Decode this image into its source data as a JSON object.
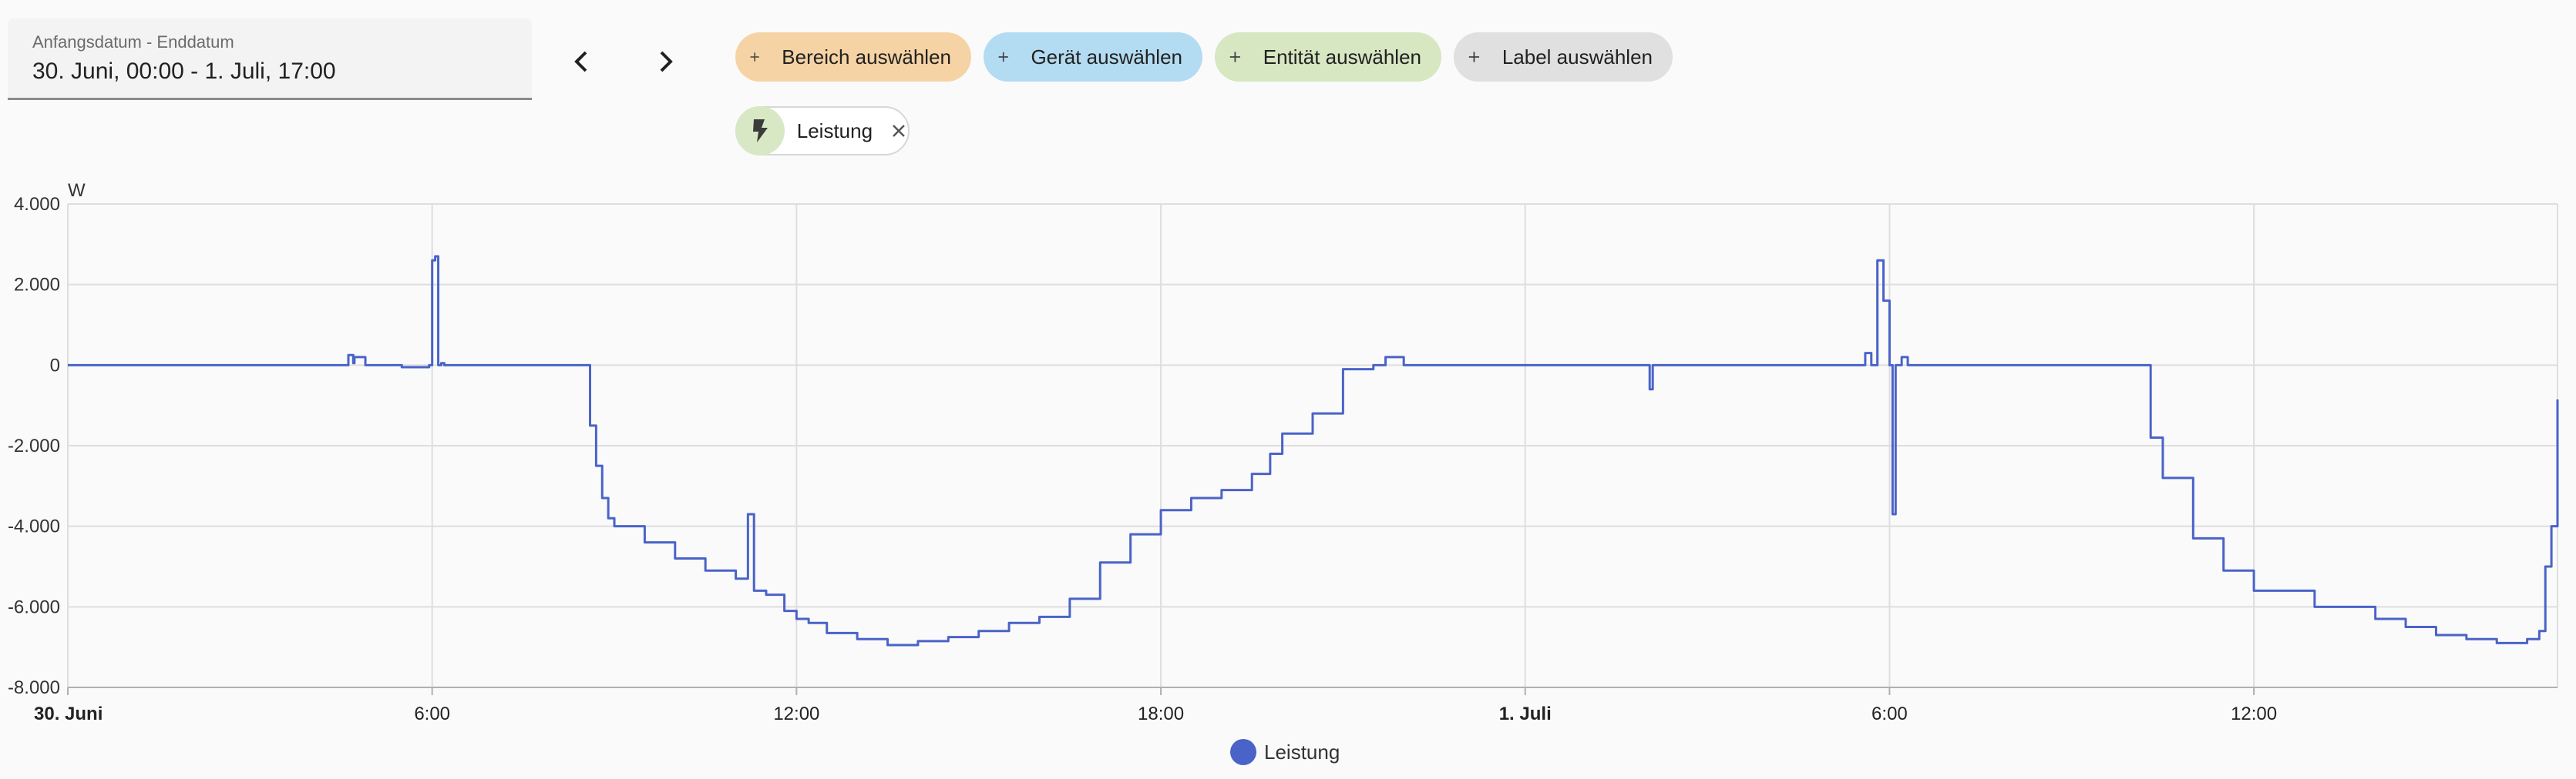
{
  "date_picker": {
    "label": "Anfangsdatum - Enddatum",
    "value": "30. Juni, 00:00 - 1. Juli, 17:00"
  },
  "nav": {
    "prev_icon": "chevron-left-icon",
    "next_icon": "chevron-right-icon"
  },
  "target_chips": [
    {
      "label": "Bereich auswählen",
      "color": "#f6d3a4",
      "icon": "plus-icon"
    },
    {
      "label": "Gerät auswählen",
      "color": "#b3dcf2",
      "icon": "plus-icon"
    },
    {
      "label": "Entität auswählen",
      "color": "#d6e7c2",
      "icon": "plus-icon"
    },
    {
      "label": "Label auswählen",
      "color": "#e0e0e0",
      "icon": "plus-icon"
    }
  ],
  "selected_filter": {
    "label": "Leistung",
    "icon": "flash-icon",
    "remove_icon": "close-icon"
  },
  "chart_data": {
    "type": "line",
    "unit_label": "W",
    "ylim": [
      -8000,
      4000
    ],
    "yticks": [
      {
        "v": 4000,
        "label": "4.000"
      },
      {
        "v": 2000,
        "label": "2.000"
      },
      {
        "v": 0,
        "label": "0"
      },
      {
        "v": -2000,
        "label": "-2.000"
      },
      {
        "v": -4000,
        "label": "-4.000"
      },
      {
        "v": -6000,
        "label": "-6.000"
      },
      {
        "v": -8000,
        "label": "-8.000"
      }
    ],
    "xlim": [
      0,
      41
    ],
    "xticks": [
      {
        "h": 0,
        "label": "30. Juni",
        "bold": true
      },
      {
        "h": 6,
        "label": "6:00",
        "bold": false
      },
      {
        "h": 12,
        "label": "12:00",
        "bold": false
      },
      {
        "h": 18,
        "label": "18:00",
        "bold": false
      },
      {
        "h": 24,
        "label": "1. Juli",
        "bold": true
      },
      {
        "h": 30,
        "label": "6:00",
        "bold": false
      },
      {
        "h": 36,
        "label": "12:00",
        "bold": false
      }
    ],
    "grid": true,
    "legend_position": "bottom-center",
    "series": [
      {
        "name": "Leistung",
        "color": "#4a63c8",
        "x": [
          0,
          4.6,
          4.62,
          4.7,
          4.72,
          4.9,
          5.5,
          5.95,
          6.0,
          6.05,
          6.1,
          6.15,
          6.2,
          7.5,
          8.5,
          8.6,
          8.7,
          8.8,
          8.9,
          9.0,
          9.5,
          10.0,
          10.5,
          11.0,
          11.2,
          11.3,
          11.5,
          11.8,
          12.0,
          12.2,
          12.5,
          13.0,
          13.5,
          14.0,
          14.5,
          15.0,
          15.5,
          16.0,
          16.5,
          17.0,
          17.5,
          18.0,
          18.5,
          19.0,
          19.5,
          19.8,
          20.0,
          20.5,
          21.0,
          21.5,
          21.7,
          22.0,
          23.0,
          24.0,
          25.0,
          26.0,
          26.05,
          26.1,
          27.0,
          28.0,
          29.0,
          29.5,
          29.6,
          29.7,
          29.8,
          29.9,
          30.0,
          30.05,
          30.1,
          30.2,
          30.3,
          30.5,
          31.0,
          32.0,
          33.0,
          33.5,
          34.0,
          34.3,
          34.5,
          35.0,
          35.5,
          36.0,
          37.0,
          38.0,
          38.5,
          39.0,
          39.5,
          40.0,
          40.5,
          40.7,
          40.8,
          40.9,
          41.0
        ],
        "y": [
          0,
          0,
          250,
          50,
          200,
          0,
          -50,
          0,
          2600,
          2700,
          0,
          50,
          0,
          0,
          0,
          -1500,
          -2500,
          -3300,
          -3800,
          -4000,
          -4400,
          -4800,
          -5100,
          -5300,
          -3700,
          -5600,
          -5700,
          -6100,
          -6300,
          -6400,
          -6650,
          -6800,
          -6950,
          -6850,
          -6750,
          -6600,
          -6400,
          -6250,
          -5800,
          -4900,
          -4200,
          -3600,
          -3300,
          -3100,
          -2700,
          -2200,
          -1700,
          -1200,
          -100,
          0,
          200,
          0,
          0,
          0,
          0,
          0,
          -600,
          0,
          0,
          0,
          0,
          0,
          300,
          0,
          2600,
          1600,
          0,
          -3700,
          0,
          200,
          0,
          0,
          0,
          0,
          0,
          0,
          0,
          -1800,
          -2800,
          -4300,
          -5100,
          -5600,
          -6000,
          -6300,
          -6500,
          -6700,
          -6800,
          -6900,
          -6800,
          -6600,
          -5000,
          -4000,
          -850
        ]
      }
    ]
  }
}
